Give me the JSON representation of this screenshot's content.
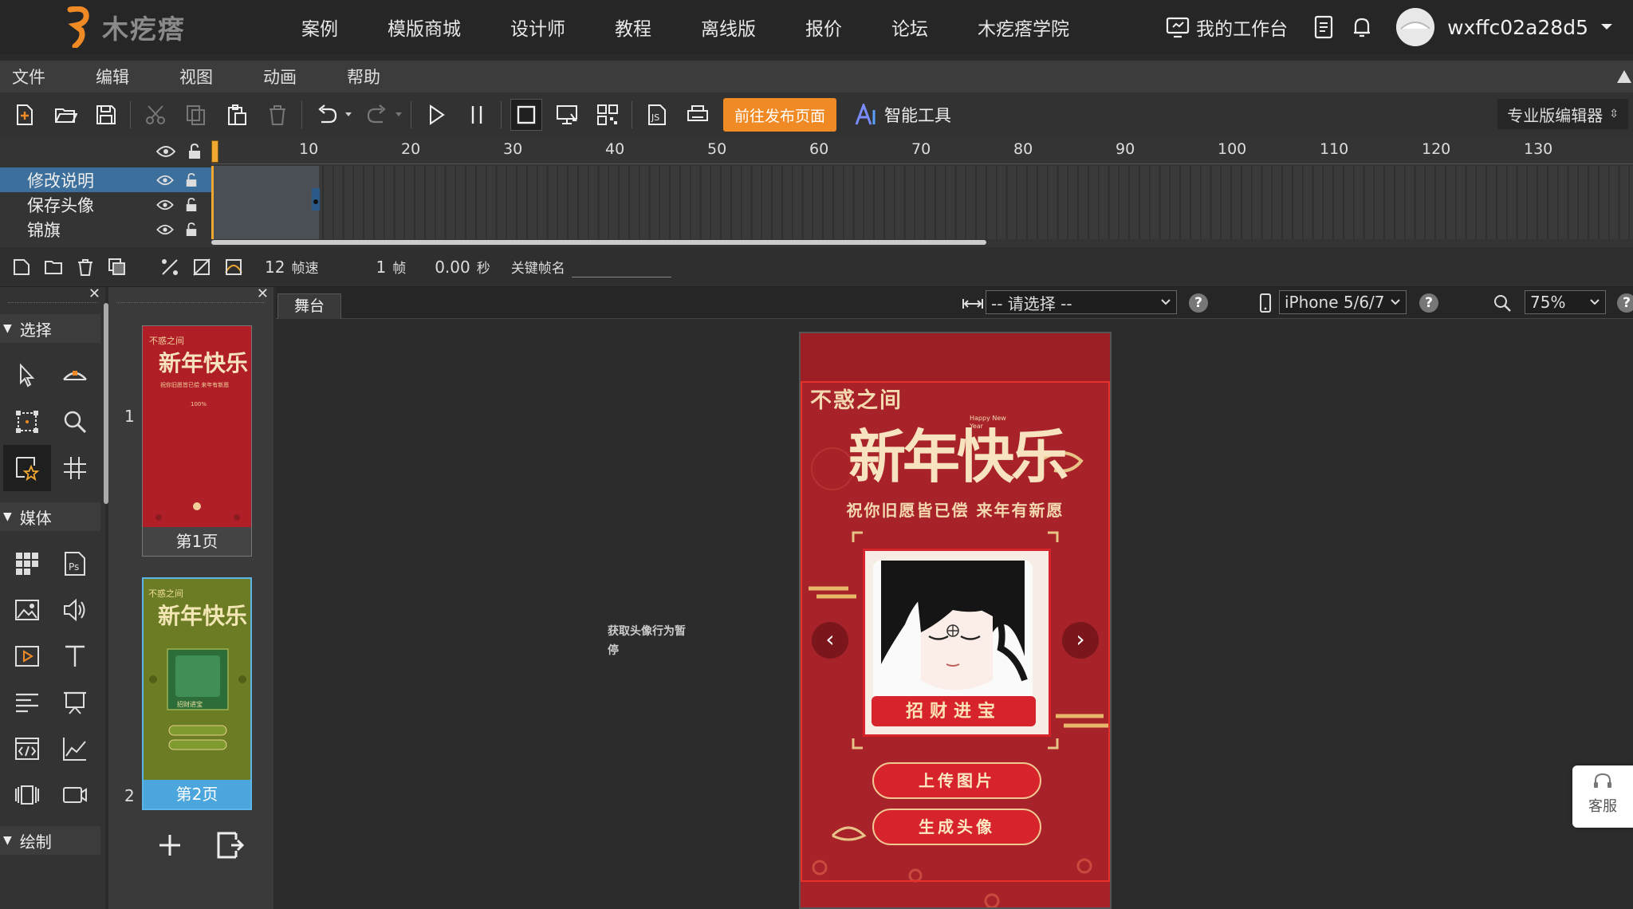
{
  "topnav": {
    "brand": "木疙瘩",
    "items": [
      "案例",
      "模版商城",
      "设计师",
      "教程",
      "离线版",
      "报价",
      "论坛",
      "木疙瘩学院"
    ],
    "workbench": "我的工作台",
    "username": "wxffc02a28d5"
  },
  "menubar": {
    "items": [
      "文件",
      "编辑",
      "视图",
      "动画",
      "帮助"
    ]
  },
  "toolbar": {
    "publish_label": "前往发布页面",
    "smart_label": "智能工具",
    "pro_label": "专业版编辑器"
  },
  "timeline": {
    "ruler_ticks": [
      "10",
      "20",
      "30",
      "40",
      "50",
      "60",
      "70",
      "80",
      "90",
      "100",
      "110",
      "120",
      "130"
    ],
    "layers": [
      {
        "name": "修改说明",
        "selected": true
      },
      {
        "name": "保存头像",
        "selected": false
      },
      {
        "name": "锦旗",
        "selected": false
      }
    ],
    "fps": "12",
    "fps_label": "帧速",
    "frame": "1",
    "frame_label": "帧",
    "seconds": "0.00",
    "seconds_label": "秒",
    "keyframe_label": "关键帧名"
  },
  "leftpanel": {
    "sections": {
      "select": "选择",
      "media": "媒体",
      "draw": "绘制"
    }
  },
  "pages": [
    {
      "num": "1",
      "label": "第1页",
      "selected": false
    },
    {
      "num": "2",
      "label": "第2页",
      "selected": true
    }
  ],
  "stage": {
    "tab": "舞台",
    "select_placeholder": "-- 请选择 --",
    "device": "iPhone 5/6/7",
    "zoom": "75%",
    "note": "获取头像行为暂停",
    "phone": {
      "title_small": "不惑之间",
      "title_big": "新年快乐",
      "happy": "Happy New Year",
      "subtitle": "祝你旧愿皆已偿 来年有新愿",
      "banner": "招财进宝",
      "upload_btn": "上传图片",
      "generate_btn": "生成头像"
    }
  },
  "kefu": "客服",
  "colors": {
    "accent": "#f08a24",
    "selection": "#3c6f9b",
    "phone_bg": "#a8222a"
  }
}
